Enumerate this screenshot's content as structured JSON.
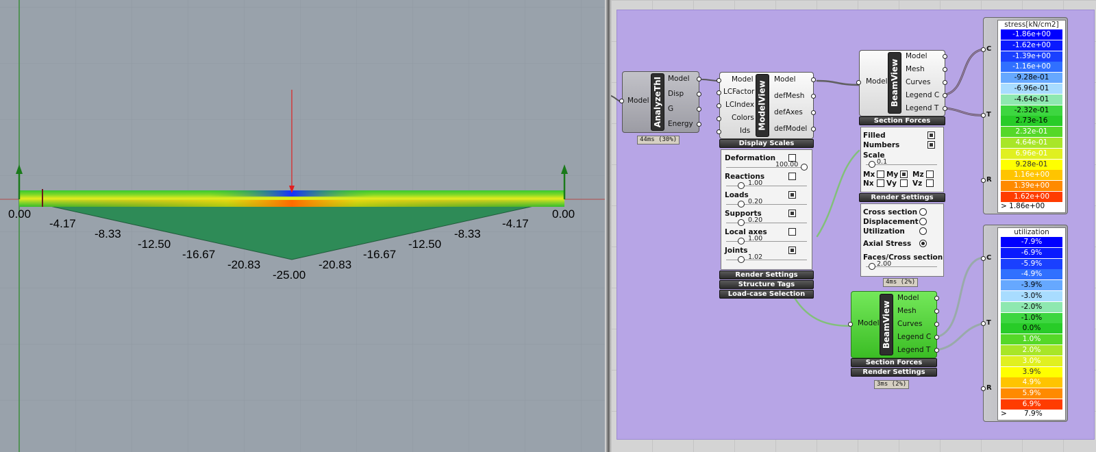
{
  "viewport": {
    "moment_labels": [
      "0.00",
      "-4.17",
      "-8.33",
      "-12.50",
      "-16.67",
      "-20.83",
      "-25.00",
      "-20.83",
      "-16.67",
      "-12.50",
      "-8.33",
      "-4.17",
      "0.00"
    ]
  },
  "components": {
    "analyze": {
      "title": "AnalyzeThI",
      "input": "Model",
      "outputs": [
        "Model",
        "Disp",
        "G",
        "Energy"
      ],
      "timing": "44ms (30%)"
    },
    "modelview": {
      "title": "ModelView",
      "inputs": [
        "Model",
        "LCFactor",
        "LCIndex",
        "Colors",
        "Ids"
      ],
      "outputs": [
        "Model",
        "defMesh",
        "defAxes",
        "defModel"
      ],
      "bar_display": "Display Scales",
      "settings": [
        {
          "label": "Deformation",
          "checked": false,
          "value": "100.00"
        },
        {
          "label": "Reactions",
          "checked": false,
          "value": "1.00"
        },
        {
          "label": "Loads",
          "checked": true,
          "value": "0.20"
        },
        {
          "label": "Supports",
          "checked": true,
          "value": "0.20"
        },
        {
          "label": "Local axes",
          "checked": false,
          "value": "1.00"
        },
        {
          "label": "Joints",
          "checked": true,
          "value": "1.02"
        }
      ],
      "bars": [
        "Render Settings",
        "Structure Tags",
        "Load-case Selection"
      ]
    },
    "beamview1": {
      "title": "BeamView",
      "input": "Model",
      "outputs": [
        "Model",
        "Mesh",
        "Curves",
        "Legend C",
        "Legend T"
      ],
      "bar_forces": "Section Forces",
      "filled": "Filled",
      "numbers": "Numbers",
      "scale_label": "Scale",
      "scale_value": "0.1",
      "forces": [
        {
          "label": "Mx",
          "checked": false
        },
        {
          "label": "My",
          "checked": true
        },
        {
          "label": "Mz",
          "checked": false
        },
        {
          "label": "Nx",
          "checked": false
        },
        {
          "label": "Vy",
          "checked": false
        },
        {
          "label": "Vz",
          "checked": false
        }
      ],
      "bar_render": "Render Settings",
      "render_options": [
        {
          "label": "Cross section",
          "selected": false
        },
        {
          "label": "Displacement",
          "selected": false
        },
        {
          "label": "Utilization",
          "selected": false
        },
        {
          "label": "Axial Stress",
          "selected": true
        }
      ],
      "faces_label": "Faces/Cross section",
      "faces_value": "2.00",
      "timing": "4ms (2%)"
    },
    "beamview2": {
      "title": "BeamView",
      "input": "Model",
      "outputs": [
        "Model",
        "Mesh",
        "Curves",
        "Legend C",
        "Legend T"
      ],
      "bars": [
        "Section Forces",
        "Render Settings"
      ],
      "timing": "3ms (2%)"
    }
  },
  "legend_stress": {
    "inputs": [
      "C",
      "T",
      "R"
    ],
    "title": "stress[kN/cm2]",
    "rows": [
      "-1.86e+00",
      "-1.62e+00",
      "-1.39e+00",
      "-1.16e+00",
      "-9.28e-01",
      "-6.96e-01",
      "-4.64e-01",
      "-2.32e-01",
      "2.73e-16",
      "2.32e-01",
      "4.64e-01",
      "6.96e-01",
      "9.28e-01",
      "1.16e+00",
      "1.39e+00",
      "1.62e+00"
    ],
    "colors": [
      "#0000ff",
      "#0a1aff",
      "#1a40ff",
      "#3070ff",
      "#66a8ff",
      "#a8dcff",
      "#8ee8b0",
      "#3dd640",
      "#28cc28",
      "#55d828",
      "#a8e628",
      "#e0f020",
      "#ffff00",
      "#ffc400",
      "#ff8a00",
      "#ff3c00"
    ],
    "footer": ">  1.86e+00"
  },
  "legend_util": {
    "inputs": [
      "C",
      "T",
      "R"
    ],
    "title": "utilization",
    "rows": [
      "-7.9%",
      "-6.9%",
      "-5.9%",
      "-4.9%",
      "-3.9%",
      "-3.0%",
      "-2.0%",
      "-1.0%",
      "0.0%",
      "1.0%",
      "2.0%",
      "3.0%",
      "3.9%",
      "4.9%",
      "5.9%",
      "6.9%"
    ],
    "colors": [
      "#0000ff",
      "#0a1aff",
      "#1a40ff",
      "#3070ff",
      "#66a8ff",
      "#a8dcff",
      "#8ee8b0",
      "#3dd640",
      "#28cc28",
      "#55d828",
      "#a8e628",
      "#e0f020",
      "#ffff00",
      "#ffc400",
      "#ff8a00",
      "#ff3c00"
    ],
    "footer_arrow": ">",
    "footer_value": "7.9%"
  }
}
